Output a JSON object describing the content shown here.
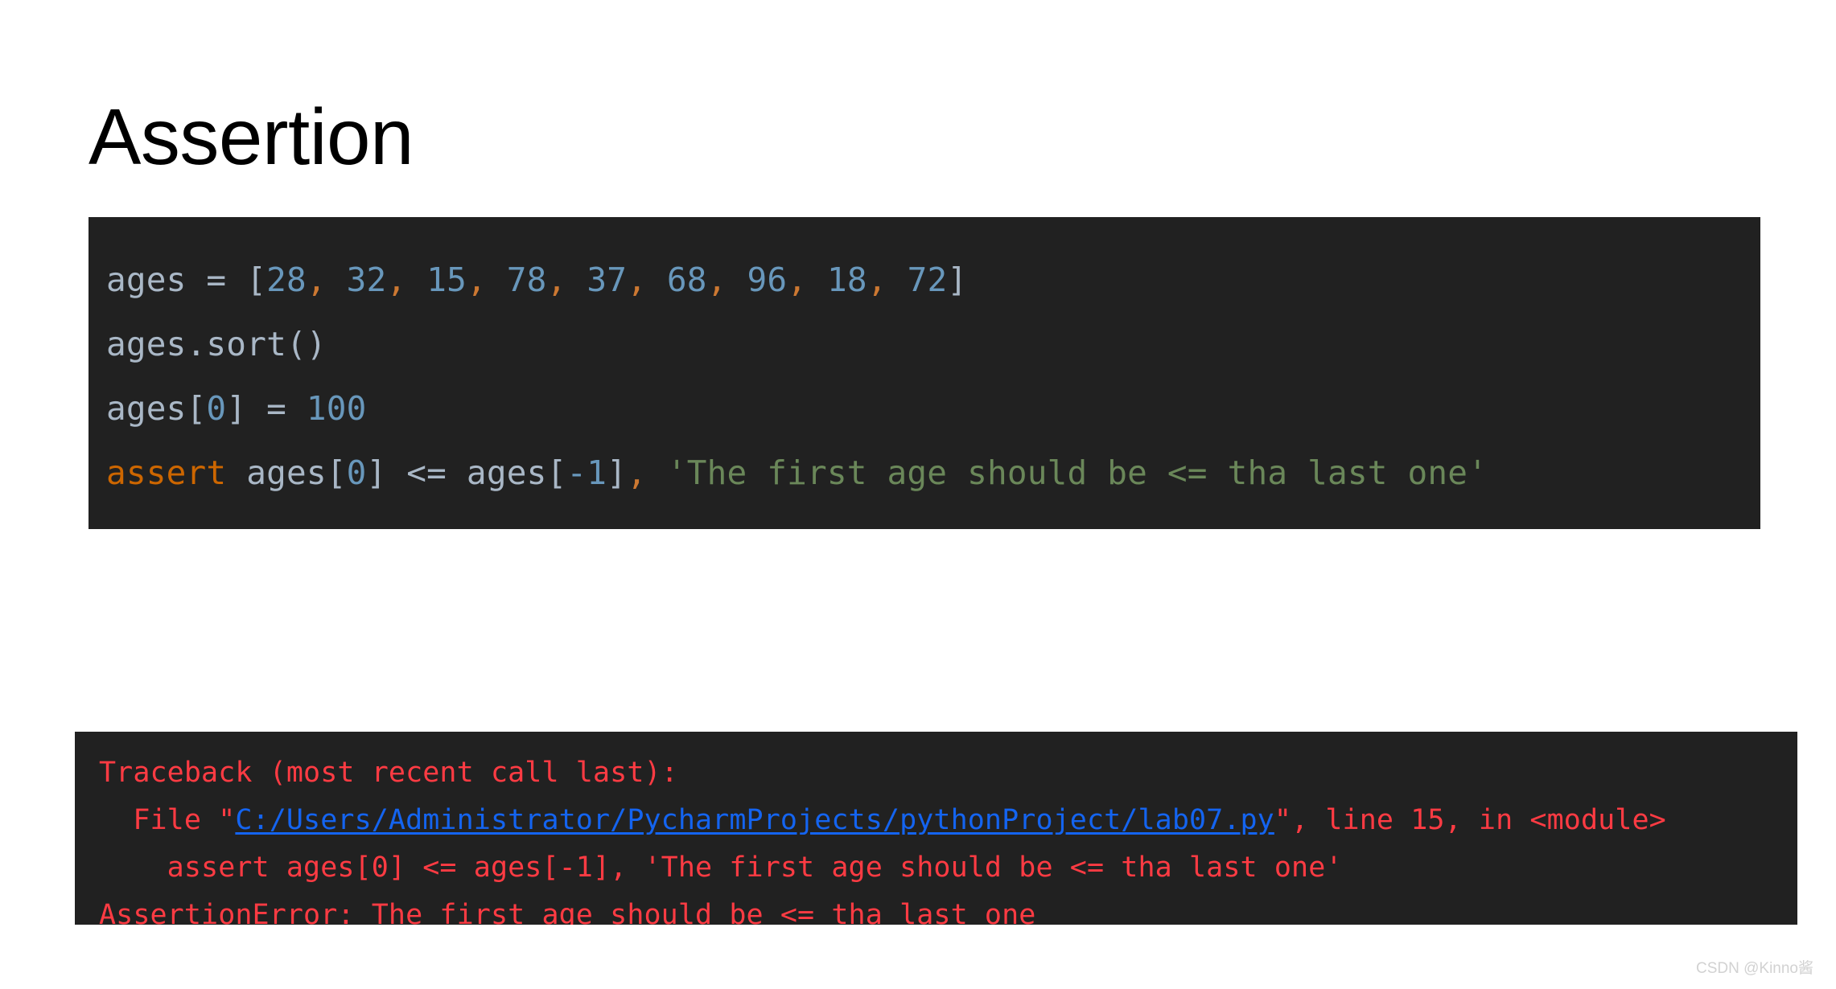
{
  "slide": {
    "title": "Assertion"
  },
  "code_block": {
    "background": "#212121",
    "lines": [
      {
        "id": "code-line-1",
        "tokens": [
          {
            "text": "ages = [",
            "type": "default"
          },
          {
            "text": "28",
            "type": "number"
          },
          {
            "text": ",",
            "type": "comma"
          },
          {
            "text": " ",
            "type": "default"
          },
          {
            "text": "32",
            "type": "number"
          },
          {
            "text": ",",
            "type": "comma"
          },
          {
            "text": " ",
            "type": "default"
          },
          {
            "text": "15",
            "type": "number"
          },
          {
            "text": ",",
            "type": "comma"
          },
          {
            "text": " ",
            "type": "default"
          },
          {
            "text": "78",
            "type": "number"
          },
          {
            "text": ",",
            "type": "comma"
          },
          {
            "text": " ",
            "type": "default"
          },
          {
            "text": "37",
            "type": "number"
          },
          {
            "text": ",",
            "type": "comma"
          },
          {
            "text": " ",
            "type": "default"
          },
          {
            "text": "68",
            "type": "number"
          },
          {
            "text": ",",
            "type": "comma"
          },
          {
            "text": " ",
            "type": "default"
          },
          {
            "text": "96",
            "type": "number"
          },
          {
            "text": ",",
            "type": "comma"
          },
          {
            "text": " ",
            "type": "default"
          },
          {
            "text": "18",
            "type": "number"
          },
          {
            "text": ",",
            "type": "comma"
          },
          {
            "text": " ",
            "type": "default"
          },
          {
            "text": "72",
            "type": "number"
          },
          {
            "text": "]",
            "type": "default"
          }
        ]
      },
      {
        "id": "code-line-2",
        "tokens": [
          {
            "text": "ages.sort()",
            "type": "default"
          }
        ]
      },
      {
        "id": "code-line-3",
        "tokens": [
          {
            "text": "ages[",
            "type": "default"
          },
          {
            "text": "0",
            "type": "number"
          },
          {
            "text": "] = ",
            "type": "default"
          },
          {
            "text": "100",
            "type": "number"
          }
        ]
      },
      {
        "id": "code-line-4",
        "tokens": [
          {
            "text": "assert",
            "type": "keyword"
          },
          {
            "text": " ages[",
            "type": "default"
          },
          {
            "text": "0",
            "type": "number"
          },
          {
            "text": "] <= ages[",
            "type": "default"
          },
          {
            "text": "-1",
            "type": "number"
          },
          {
            "text": "]",
            "type": "default"
          },
          {
            "text": ",",
            "type": "comma"
          },
          {
            "text": " ",
            "type": "default"
          },
          {
            "text": "'The first age should be <= tha last one'",
            "type": "string"
          }
        ]
      }
    ]
  },
  "traceback_block": {
    "background": "#212121",
    "lines": [
      {
        "id": "traceback-line-1",
        "tokens": [
          {
            "text": "Traceback (most recent call last):",
            "type": "err"
          }
        ]
      },
      {
        "id": "traceback-line-2",
        "tokens": [
          {
            "text": "  File \"",
            "type": "err"
          },
          {
            "text": "C:/Users/Administrator/PycharmProjects/pythonProject/lab07.py",
            "type": "link"
          },
          {
            "text": "\", line 15, in <module>",
            "type": "err"
          }
        ]
      },
      {
        "id": "traceback-line-3",
        "tokens": [
          {
            "text": "    assert ages[0] <= ages[-1], 'The first age should be <= tha last one'",
            "type": "err"
          }
        ]
      },
      {
        "id": "traceback-line-4",
        "tokens": [
          {
            "text": "AssertionError: The first age should be <= tha last one",
            "type": "err"
          }
        ]
      }
    ]
  },
  "watermark": {
    "text": "CSDN @Kinno酱"
  }
}
